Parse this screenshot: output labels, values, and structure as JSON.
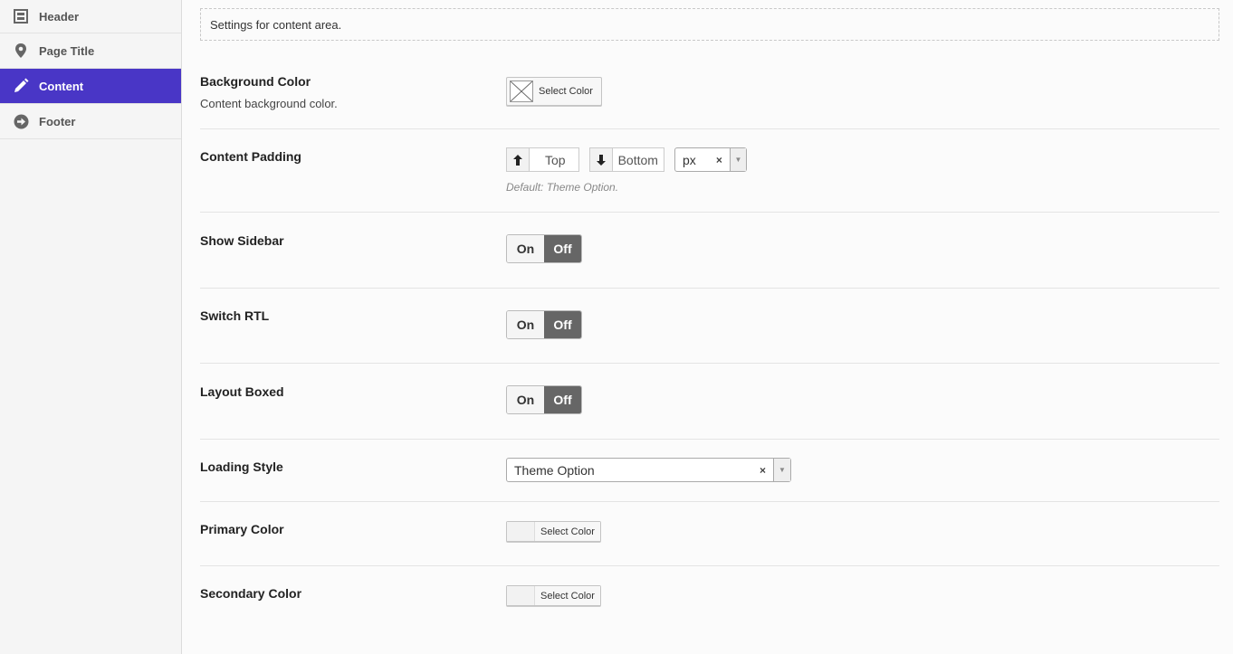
{
  "sidebar": {
    "items": [
      {
        "label": "Header",
        "icon": "layout-icon"
      },
      {
        "label": "Page Title",
        "icon": "map-pin-icon"
      },
      {
        "label": "Content",
        "icon": "pencil-icon",
        "active": true
      },
      {
        "label": "Footer",
        "icon": "arrow-circle-right-icon"
      }
    ]
  },
  "main": {
    "notice": "Settings for content area.",
    "background_color": {
      "label": "Background Color",
      "description": "Content background color.",
      "button": "Select Color"
    },
    "content_padding": {
      "label": "Content Padding",
      "top": "Top",
      "bottom": "Bottom",
      "unit": "px",
      "clear": "×",
      "hint": "Default: Theme Option."
    },
    "show_sidebar": {
      "label": "Show Sidebar",
      "on": "On",
      "off": "Off",
      "value": "Off"
    },
    "switch_rtl": {
      "label": "Switch RTL",
      "on": "On",
      "off": "Off",
      "value": "Off"
    },
    "layout_boxed": {
      "label": "Layout Boxed",
      "on": "On",
      "off": "Off",
      "value": "Off"
    },
    "loading_style": {
      "label": "Loading Style",
      "value": "Theme Option",
      "clear": "×"
    },
    "primary_color": {
      "label": "Primary Color",
      "button": "Select Color"
    },
    "secondary_color": {
      "label": "Secondary Color",
      "button": "Select Color"
    }
  },
  "colors": {
    "accent": "#4936c6",
    "toggle_off": "#666666"
  }
}
